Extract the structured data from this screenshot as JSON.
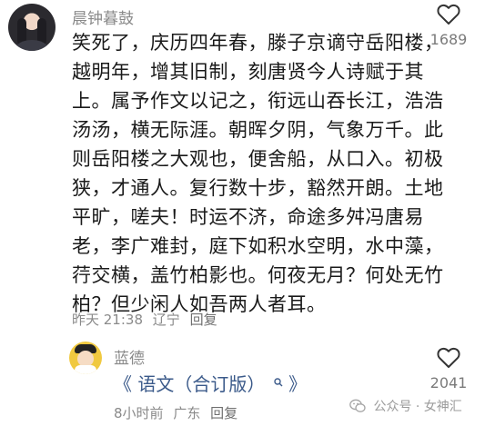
{
  "comments": [
    {
      "username": "晨钟暮鼓",
      "avatar_icon": "avatar-woman-dark-hair",
      "lines": [
        "笑死了，庆历四年春，滕子京谪守岳阳楼，",
        "越明年，增其旧制，刻唐贤今人诗赋于其",
        "上。属予作文以记之，衔远山吞长江，浩浩",
        "汤汤，横无际涯。朝晖夕阴，气象万千。此",
        "则岳阳楼之大观也，便舍船，从口入。初极",
        "狭，才通人。复行数十步，豁然开朗。土地",
        "平旷，嗟夫！时运不济，命途多舛冯唐易",
        "老，李广难封，庭下如积水空明，水中藻，",
        "荇交横，盖竹柏影也。何夜无月？何处无竹",
        "柏？但少闲人如吾两人者耳。"
      ],
      "time": "昨天 21:38",
      "location": "辽宁",
      "reply_label": "回复",
      "likes": "1689",
      "like_icon": "heart-outline-icon"
    },
    {
      "username": "蓝德",
      "avatar_icon": "avatar-cartoon-boy-cap",
      "link_prefix": "《",
      "link_title": "语文（合订版）",
      "link_suffix": "》",
      "search_icon": "search-icon",
      "time": "8小时前",
      "location": "广东",
      "reply_label": "回复",
      "likes": "2041",
      "like_icon": "heart-outline-icon"
    }
  ],
  "watermark": {
    "text": "公众号 · 女神汇",
    "icon": "wechat-icon"
  },
  "colors": {
    "username": "#8a8a8a",
    "body_text": "#1a1a1a",
    "link": "#3b5a8a",
    "meta": "#8a8a8a"
  }
}
